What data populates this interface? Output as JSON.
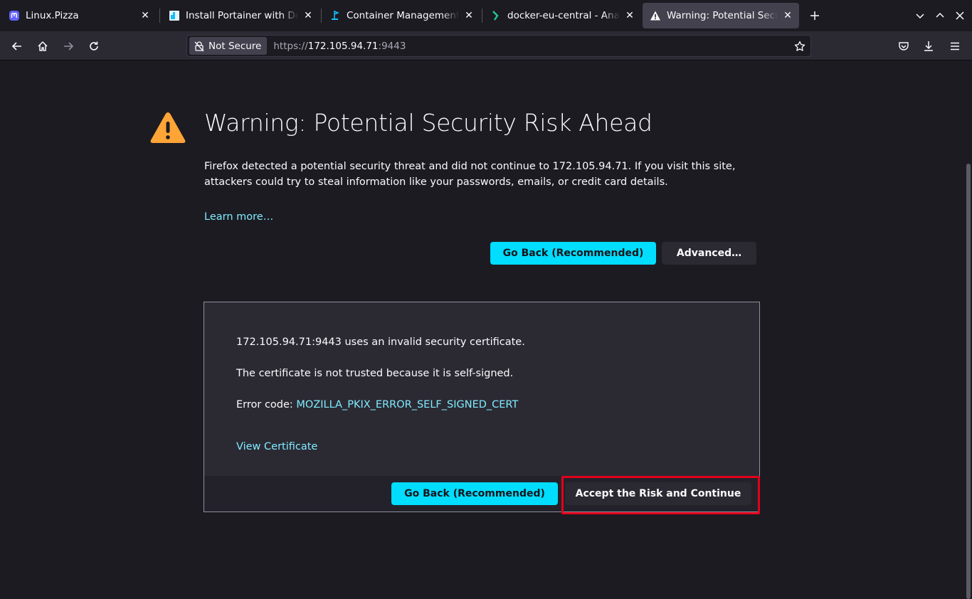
{
  "tabs": [
    {
      "title": "Linux.Pizza",
      "icon": "mastodon-icon",
      "active": false
    },
    {
      "title": "Install Portainer with Docker",
      "icon": "portainer-icon",
      "active": false
    },
    {
      "title": "Container Management | Portainer",
      "icon": "portainer-whale-icon",
      "active": false
    },
    {
      "title": "docker-eu-central - Analytics",
      "icon": "analytics-icon",
      "active": false
    },
    {
      "title": "Warning: Potential Security Risk Ahead",
      "icon": "warning-icon",
      "active": true
    }
  ],
  "urlbar": {
    "security_label": "Not Secure",
    "url_protocol": "https://",
    "url_host": "172.105.94.71",
    "url_port": ":9443"
  },
  "page": {
    "title": "Warning: Potential Security Risk Ahead",
    "intro": "Firefox detected a potential security threat and did not continue to 172.105.94.71. If you visit this site, attackers could try to steal information like your passwords, emails, or credit card details.",
    "learn_more": "Learn more…",
    "go_back": "Go Back (Recommended)",
    "advanced": "Advanced…"
  },
  "advanced_panel": {
    "invalid_cert": "172.105.94.71:9443 uses an invalid security certificate.",
    "not_trusted": "The certificate is not trusted because it is self-signed.",
    "error_code_label": "Error code: ",
    "error_code": "MOZILLA_PKIX_ERROR_SELF_SIGNED_CERT",
    "view_certificate": "View Certificate",
    "go_back": "Go Back (Recommended)",
    "accept": "Accept the Risk and Continue"
  },
  "colors": {
    "accent": "#00ddff",
    "link": "#80ebff",
    "warning": "#ffa436",
    "highlight": "#e2001a"
  }
}
